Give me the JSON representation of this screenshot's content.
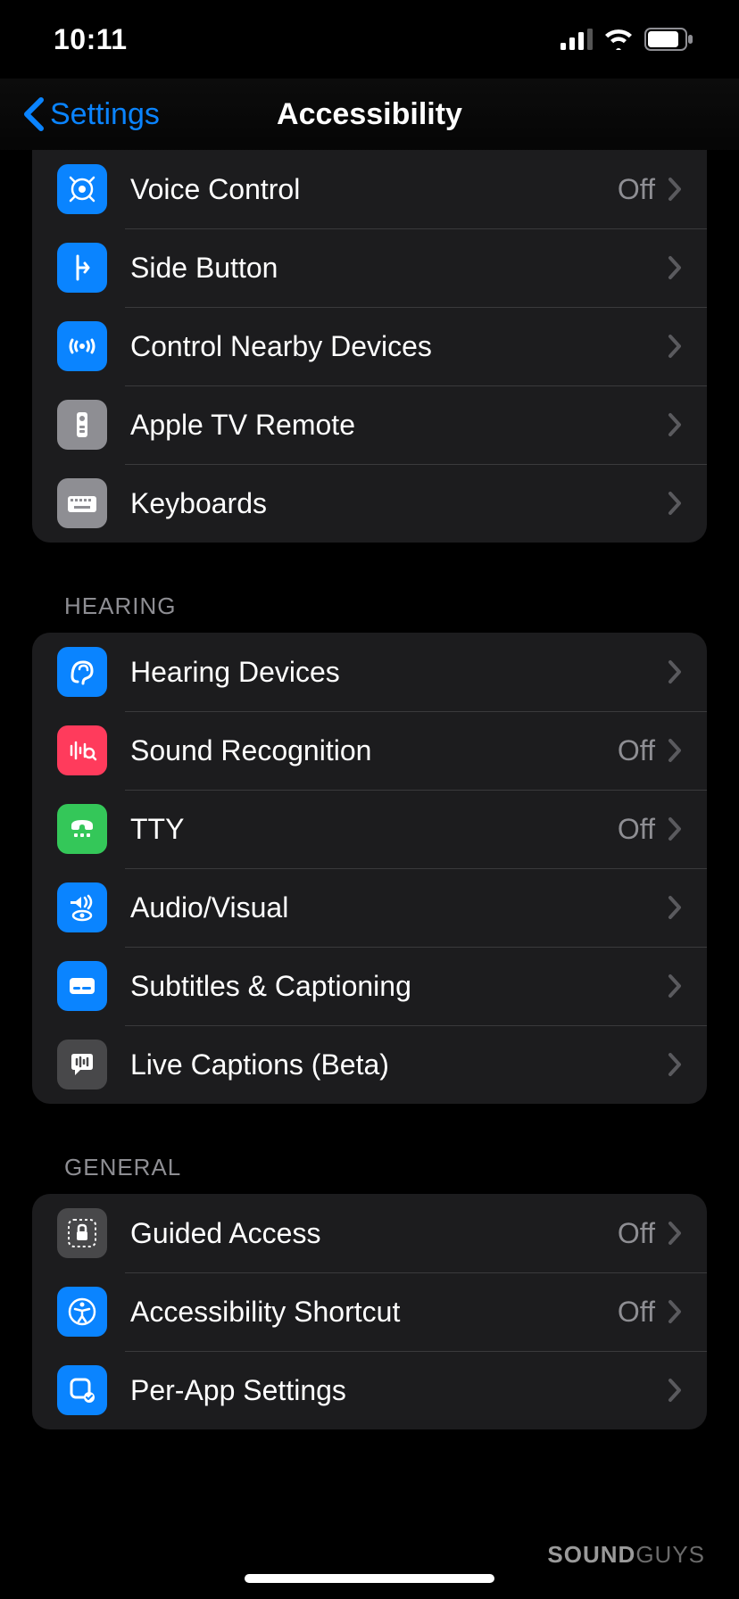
{
  "status": {
    "time": "10:11"
  },
  "nav": {
    "back": "Settings",
    "title": "Accessibility"
  },
  "sections": {
    "s0": [
      {
        "label": "Voice Control",
        "value": "Off"
      },
      {
        "label": "Side Button",
        "value": ""
      },
      {
        "label": "Control Nearby Devices",
        "value": ""
      },
      {
        "label": "Apple TV Remote",
        "value": ""
      },
      {
        "label": "Keyboards",
        "value": ""
      }
    ],
    "hearing_header": "HEARING",
    "s1": [
      {
        "label": "Hearing Devices",
        "value": ""
      },
      {
        "label": "Sound Recognition",
        "value": "Off"
      },
      {
        "label": "TTY",
        "value": "Off"
      },
      {
        "label": "Audio/Visual",
        "value": ""
      },
      {
        "label": "Subtitles & Captioning",
        "value": ""
      },
      {
        "label": "Live Captions (Beta)",
        "value": ""
      }
    ],
    "general_header": "GENERAL",
    "s2": [
      {
        "label": "Guided Access",
        "value": "Off"
      },
      {
        "label": "Accessibility Shortcut",
        "value": "Off"
      },
      {
        "label": "Per-App Settings",
        "value": ""
      }
    ]
  },
  "watermark": {
    "a": "SOUND",
    "b": "GUYS"
  }
}
